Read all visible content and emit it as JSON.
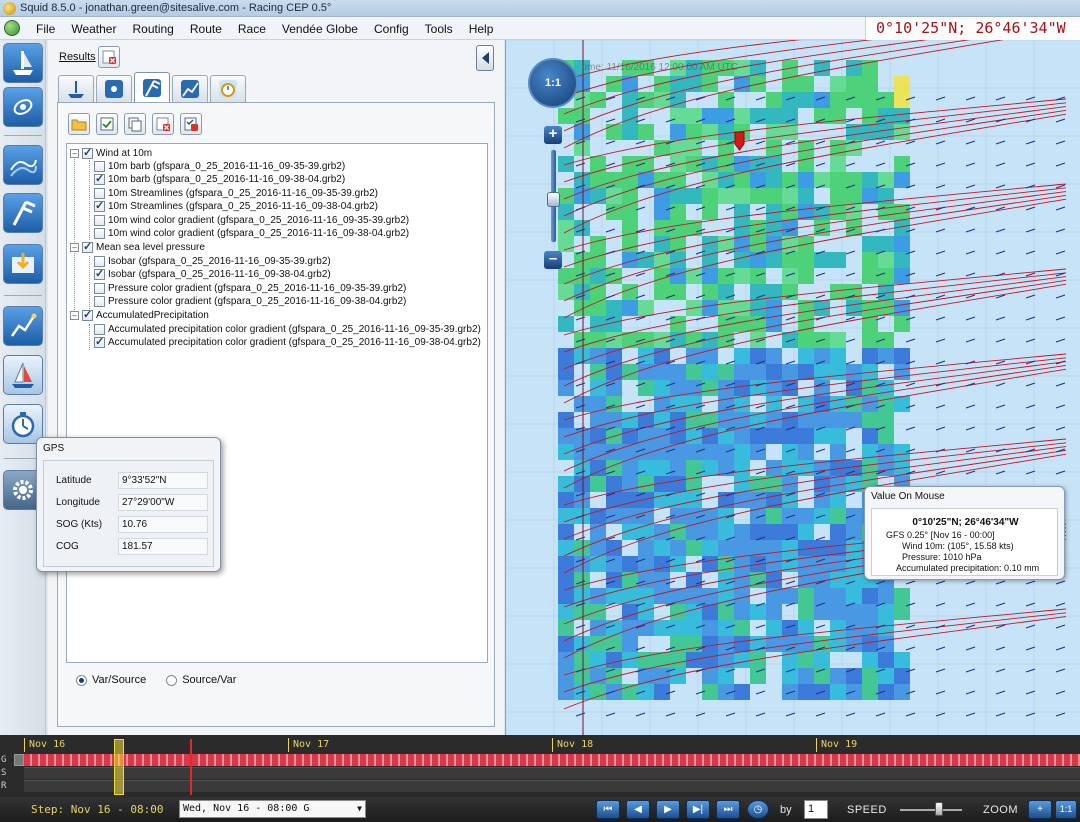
{
  "window": {
    "title": "Squid 8.5.0 - jonathan.green@sitesalive.com - Racing CEP 0.5°"
  },
  "menu": {
    "items": [
      "File",
      "Weather",
      "Routing",
      "Route",
      "Race",
      "Vendée Globe",
      "Config",
      "Tools",
      "Help"
    ],
    "coords_display": "0°10'25\"N; 26°46'34\"W"
  },
  "left_panel": {
    "results_label": "Results",
    "tree": {
      "groups": [
        {
          "label": "Wind at 10m",
          "checked": true,
          "items": [
            {
              "label": "10m barb (gfspara_0_25_2016-11-16_09-35-39.grb2)",
              "checked": false
            },
            {
              "label": "10m barb (gfspara_0_25_2016-11-16_09-38-04.grb2)",
              "checked": true
            },
            {
              "label": "10m Streamlines (gfspara_0_25_2016-11-16_09-35-39.grb2)",
              "checked": false
            },
            {
              "label": "10m Streamlines (gfspara_0_25_2016-11-16_09-38-04.grb2)",
              "checked": true
            },
            {
              "label": "10m wind color gradient (gfspara_0_25_2016-11-16_09-35-39.grb2)",
              "checked": false
            },
            {
              "label": "10m wind color gradient (gfspara_0_25_2016-11-16_09-38-04.grb2)",
              "checked": false
            }
          ]
        },
        {
          "label": "Mean sea level pressure",
          "checked": true,
          "items": [
            {
              "label": "Isobar (gfspara_0_25_2016-11-16_09-35-39.grb2)",
              "checked": false
            },
            {
              "label": "Isobar (gfspara_0_25_2016-11-16_09-38-04.grb2)",
              "checked": true
            },
            {
              "label": "Pressure color gradient (gfspara_0_25_2016-11-16_09-35-39.grb2)",
              "checked": false
            },
            {
              "label": "Pressure color gradient (gfspara_0_25_2016-11-16_09-38-04.grb2)",
              "checked": false
            }
          ]
        },
        {
          "label": "AccumulatedPrecipitation",
          "checked": true,
          "items": [
            {
              "label": "Accumulated precipitation color gradient (gfspara_0_25_2016-11-16_09-35-39.grb2)",
              "checked": false
            },
            {
              "label": "Accumulated precipitation color gradient (gfspara_0_25_2016-11-16_09-38-04.grb2)",
              "checked": true
            }
          ]
        }
      ]
    },
    "radio_var_source": "Var/Source",
    "radio_source_var": "Source/Var",
    "radio_selected": "Var/Source"
  },
  "gps": {
    "title": "GPS",
    "latitude_label": "Latitude",
    "latitude_value": "9°33'52\"N",
    "longitude_label": "Longitude",
    "longitude_value": "27°29'00\"W",
    "sog_label": "SOG (Kts)",
    "sog_value": "10.76",
    "cog_label": "COG",
    "cog_value": "181.57"
  },
  "map": {
    "time_label": "time: 11/16/2016 12:00:00 AM UTC",
    "compass_label": "1:1",
    "zoom_in": "+",
    "zoom_out": "–"
  },
  "value_on_mouse": {
    "title": "Value On Mouse",
    "coords": "0°10'25\"N; 26°46'34\"W",
    "source": "GFS 0.25°  [Nov 16 - 00:00]",
    "wind": "Wind 10m: (105°, 15.58 kts)",
    "pressure": "Pressure: 1010 hPa",
    "precipitation": "Accumulated precipitation: 0.10 mm"
  },
  "timeline": {
    "dates": [
      "Nov 16",
      "Nov 17",
      "Nov 18",
      "Nov 19"
    ],
    "row_letters": [
      "G",
      "S",
      "R"
    ]
  },
  "bottom_bar": {
    "step_label": "Step: Nov 16 - 08:00",
    "date_select": "Wed, Nov 16 - 08:00 G",
    "by_label": "by",
    "by_value": "1",
    "speed_label": "SPEED",
    "zoom_label": "ZOOM",
    "zoom_ratio": "1:1"
  },
  "colors": {
    "coords_text": "#a0141a",
    "timeline_text": "#e8d36a",
    "wind_barb": "#c01825",
    "sea": "#c7e3f8"
  }
}
